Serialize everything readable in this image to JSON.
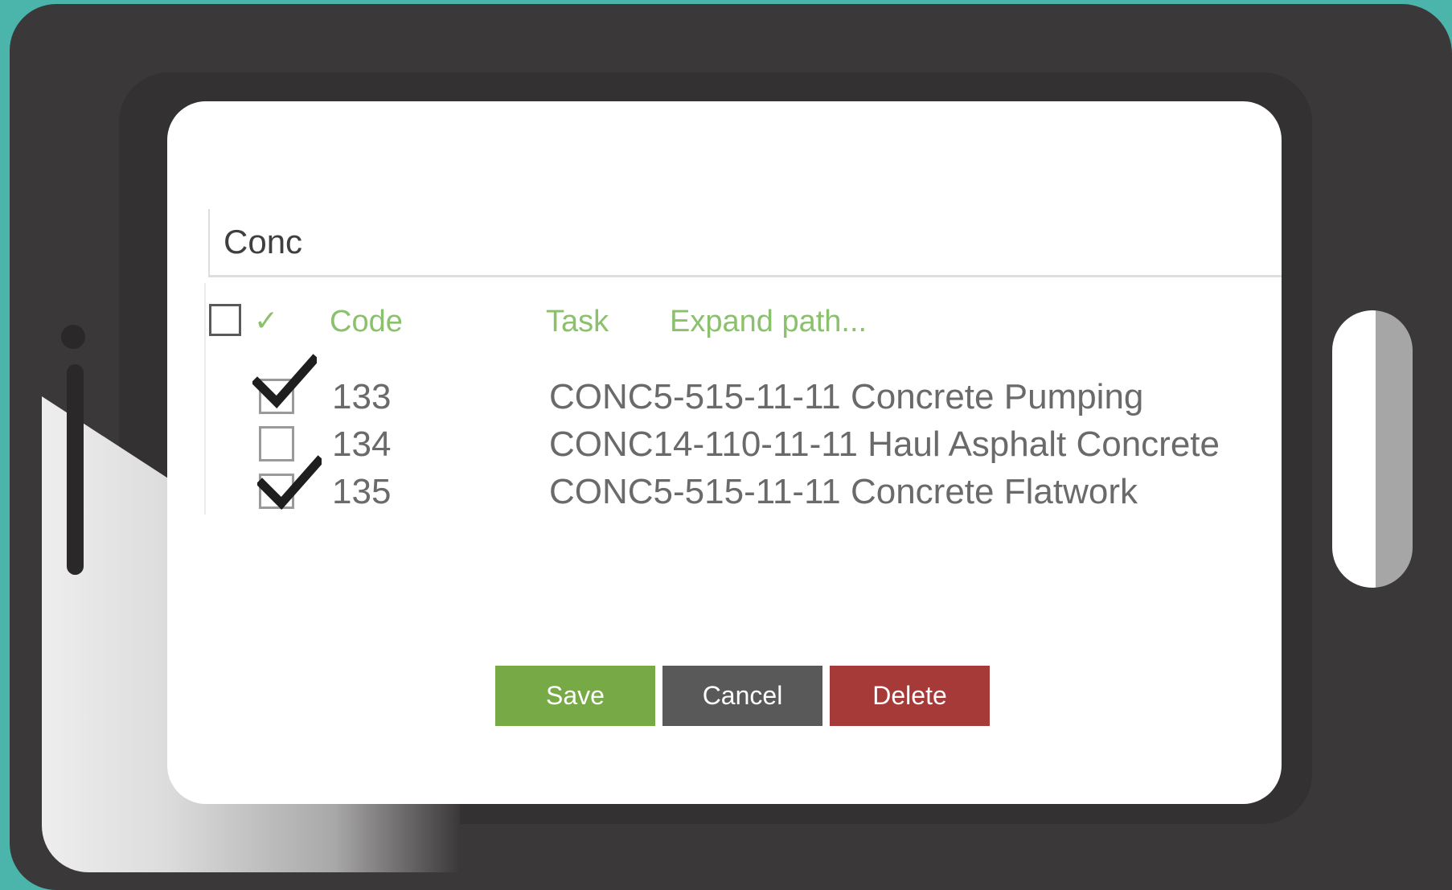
{
  "search": {
    "value": "Conc"
  },
  "list_header": {
    "check_symbol": "✓",
    "code_label": "Code",
    "task_label": "Task",
    "expand_label": "Expand path..."
  },
  "rows": [
    {
      "code": "133",
      "task": "CONC5-515-11-11 Concrete Pumping",
      "checked": true
    },
    {
      "code": "134",
      "task": "CONC14-110-11-11 Haul Asphalt Concrete",
      "checked": false
    },
    {
      "code": "135",
      "task": "CONC5-515-11-11 Concrete Flatwork",
      "checked": true
    }
  ],
  "buttons": {
    "save": "Save",
    "cancel": "Cancel",
    "delete": "Delete"
  },
  "colors": {
    "background": "#4bb5ac",
    "device": "#3b3839",
    "header_green": "#8bc16d",
    "save": "#77aa47",
    "cancel": "#595959",
    "delete": "#a63a38"
  },
  "icons": {
    "checkmark": "checkmark-icon",
    "header_check": "check-icon"
  }
}
